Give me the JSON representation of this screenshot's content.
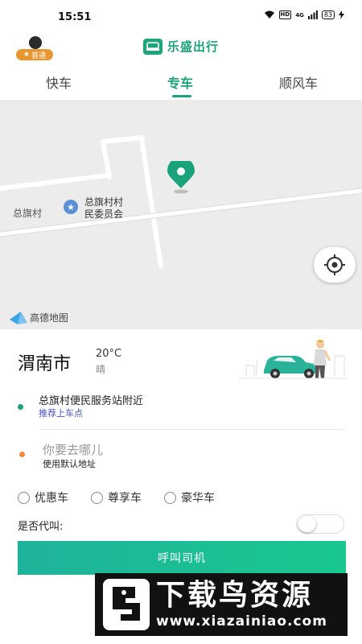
{
  "status_bar": {
    "time": "15:51",
    "hd": "HD",
    "network": "4G",
    "battery": "83"
  },
  "header": {
    "user_badge": "普通",
    "app_name": "乐盛出行"
  },
  "tabs": [
    {
      "label": "快车",
      "active": false
    },
    {
      "label": "专车",
      "active": true
    },
    {
      "label": "顺风车",
      "active": false
    }
  ],
  "map": {
    "road_label": "总旗村",
    "poi_line1": "总旗村村",
    "poi_line2": "民委员会",
    "provider": "高德地图",
    "pin_color": "#1aa37a"
  },
  "location": {
    "city": "渭南市",
    "temperature": "20°C",
    "weather": "晴"
  },
  "pickup": {
    "title": "总旗村便民服务站附近",
    "subtitle": "推荐上车点",
    "dot_color": "#1aa37a"
  },
  "destination": {
    "placeholder": "你要去哪儿",
    "subtitle": "使用默认地址",
    "dot_color": "#f08a3c"
  },
  "car_types": [
    "优惠车",
    "尊享车",
    "豪华车"
  ],
  "proxy_call": {
    "label": "是否代叫:",
    "enabled": false
  },
  "call_button": {
    "label": "呼叫司机"
  },
  "watermark": {
    "title": "下载鸟资源",
    "url": "www.xiazainiao.com"
  },
  "accent_color": "#1aa37a"
}
